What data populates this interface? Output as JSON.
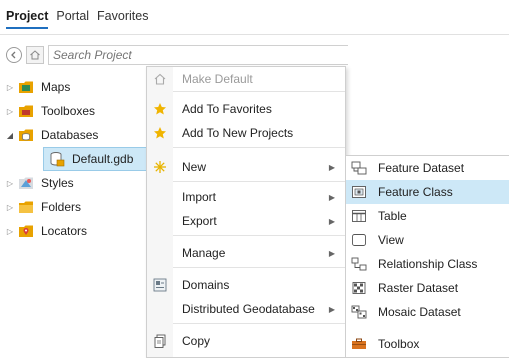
{
  "tabs": [
    "Project",
    "Portal",
    "Favorites"
  ],
  "search": {
    "placeholder": "Search Project"
  },
  "tree": [
    {
      "label": "Maps",
      "expander": "▷",
      "icon": "maps-folder-icon"
    },
    {
      "label": "Toolboxes",
      "expander": "▷",
      "icon": "toolboxes-folder-icon"
    },
    {
      "label": "Databases",
      "expander": "◢",
      "icon": "databases-folder-icon"
    },
    {
      "label": "Default.gdb",
      "expander": "",
      "icon": "geodatabase-icon",
      "selected": true
    },
    {
      "label": "Styles",
      "expander": "▷",
      "icon": "styles-icon"
    },
    {
      "label": "Folders",
      "expander": "▷",
      "icon": "folders-icon"
    },
    {
      "label": "Locators",
      "expander": "▷",
      "icon": "locators-icon"
    }
  ],
  "context_menu": [
    {
      "label": "Make Default",
      "icon": "home-icon",
      "disabled": true
    },
    {
      "label": "Add To Favorites",
      "icon": "star-icon"
    },
    {
      "label": "Add To New Projects",
      "icon": "star-icon"
    },
    {
      "label": "New",
      "icon": "new-sparkle-icon",
      "submenu": true
    },
    {
      "label": "Import",
      "submenu": true
    },
    {
      "label": "Export",
      "submenu": true
    },
    {
      "label": "Manage",
      "submenu": true
    },
    {
      "label": "Domains",
      "icon": "domains-icon"
    },
    {
      "label": "Distributed Geodatabase",
      "submenu": true
    },
    {
      "label": "Copy",
      "icon": "copy-icon"
    }
  ],
  "submenu_new": [
    {
      "label": "Feature Dataset",
      "icon": "feature-dataset-icon"
    },
    {
      "label": "Feature Class",
      "icon": "feature-class-icon",
      "highlighted": true
    },
    {
      "label": "Table",
      "icon": "table-icon"
    },
    {
      "label": "View",
      "icon": "view-icon"
    },
    {
      "label": "Relationship Class",
      "icon": "relationship-class-icon"
    },
    {
      "label": "Raster Dataset",
      "icon": "raster-dataset-icon"
    },
    {
      "label": "Mosaic Dataset",
      "icon": "mosaic-dataset-icon"
    },
    {
      "label": "Toolbox",
      "icon": "toolbox-icon"
    }
  ],
  "colors": {
    "accent": "#1f6fbf",
    "selection": "#cde8f7",
    "star": "#f0b400",
    "folder": "#e8a200"
  }
}
